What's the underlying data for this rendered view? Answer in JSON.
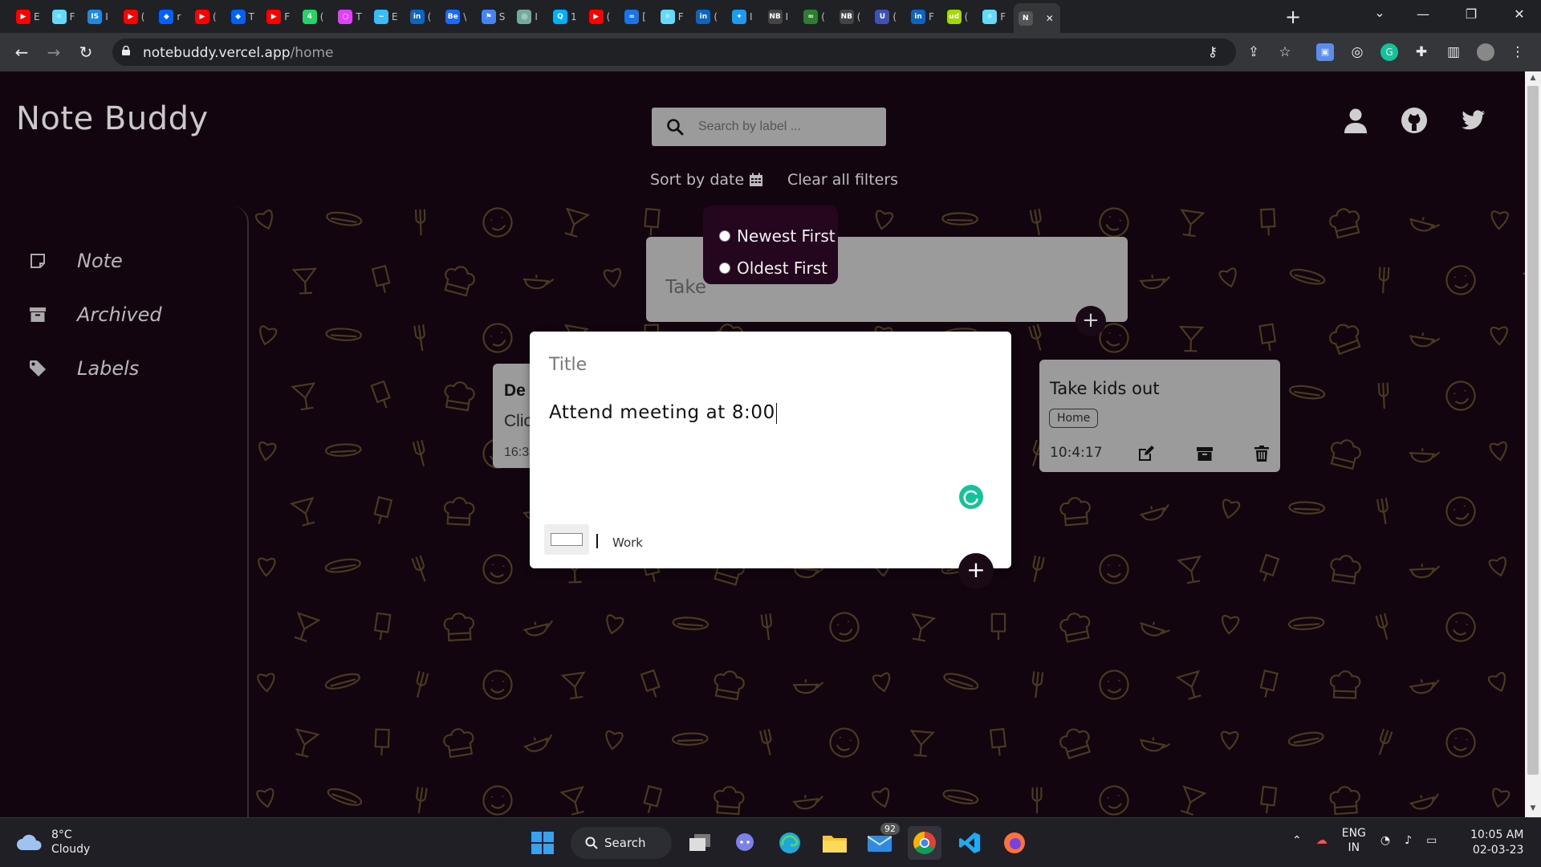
{
  "browser": {
    "tabs": [
      {
        "icon": "youtube-icon",
        "color": "#ff0000",
        "glyph": "▶",
        "letter": "E"
      },
      {
        "icon": "react-icon",
        "color": "#61dafb",
        "glyph": "⚛",
        "letter": "F"
      },
      {
        "icon": "tab-app-icon",
        "color": "#1e88e5",
        "glyph": "IS",
        "letter": "I"
      },
      {
        "icon": "youtube-icon",
        "color": "#ff0000",
        "glyph": "▶",
        "letter": "("
      },
      {
        "icon": "dropbox-icon",
        "color": "#0061fe",
        "glyph": "◆",
        "letter": "r"
      },
      {
        "icon": "youtube-icon",
        "color": "#ff0000",
        "glyph": "▶",
        "letter": "("
      },
      {
        "icon": "dropbox-icon",
        "color": "#0061fe",
        "glyph": "◆",
        "letter": "T"
      },
      {
        "icon": "youtube-icon",
        "color": "#ff0000",
        "glyph": "▶",
        "letter": "F"
      },
      {
        "icon": "whatsapp-icon",
        "color": "#25d366",
        "glyph": "4",
        "letter": "("
      },
      {
        "icon": "ring-icon",
        "color": "#e040fb",
        "glyph": "○",
        "letter": "T"
      },
      {
        "icon": "tailwind-icon",
        "color": "#38bdf8",
        "glyph": "~",
        "letter": "E"
      },
      {
        "icon": "linkedin-icon",
        "color": "#0a66c2",
        "glyph": "in",
        "letter": "("
      },
      {
        "icon": "behance-icon",
        "color": "#1769ff",
        "glyph": "Be",
        "letter": "\\"
      },
      {
        "icon": "flag-icon",
        "color": "#4285f4",
        "glyph": "⚑",
        "letter": "S"
      },
      {
        "icon": "chatgpt-icon",
        "color": "#74aa9c",
        "glyph": "◎",
        "letter": "I"
      },
      {
        "icon": "search-tab-icon",
        "color": "#00b0ff",
        "glyph": "Q",
        "letter": "1"
      },
      {
        "icon": "youtube-icon",
        "color": "#ff0000",
        "glyph": "▶",
        "letter": "("
      },
      {
        "icon": "infinity-icon",
        "color": "#1a73e8",
        "glyph": "∞",
        "letter": "["
      },
      {
        "icon": "react-icon",
        "color": "#61dafb",
        "glyph": "⚛",
        "letter": "F"
      },
      {
        "icon": "linkedin-icon",
        "color": "#0a66c2",
        "glyph": "in",
        "letter": "("
      },
      {
        "icon": "twitter-icon",
        "color": "#1d9bf0",
        "glyph": "✦",
        "letter": "I"
      },
      {
        "icon": "notebuddy-icon",
        "color": "#444444",
        "glyph": "NB",
        "letter": "I"
      },
      {
        "icon": "infinity-icon",
        "color": "#2e7d32",
        "glyph": "∞",
        "letter": "("
      },
      {
        "icon": "notebuddy-icon",
        "color": "#444444",
        "glyph": "NB",
        "letter": "("
      },
      {
        "icon": "u-icon",
        "color": "#3f51b5",
        "glyph": "U",
        "letter": "("
      },
      {
        "icon": "linkedin-icon",
        "color": "#0a66c2",
        "glyph": "in",
        "letter": "F"
      },
      {
        "icon": "ud-icon",
        "color": "#a3d900",
        "glyph": "ud",
        "letter": "("
      },
      {
        "icon": "react-icon",
        "color": "#61dafb",
        "glyph": "⚛",
        "letter": "F"
      },
      {
        "icon": "notebuddy-icon",
        "color": "#555555",
        "glyph": "N",
        "letter": "",
        "active": true
      }
    ],
    "url_host": "notebuddy.vercel.app",
    "url_path": "/home"
  },
  "app": {
    "title": "Note Buddy",
    "search_placeholder": "Search by label ...",
    "sort_by_date": "Sort by date",
    "clear_filters": "Clear all filters"
  },
  "sidebar": {
    "items": [
      {
        "label": "Note",
        "icon": "note-icon"
      },
      {
        "label": "Archived",
        "icon": "archive-icon"
      },
      {
        "label": "Labels",
        "icon": "tag-icon"
      }
    ]
  },
  "sort_dropdown": {
    "options": [
      "Newest First",
      "Oldest First"
    ]
  },
  "take_note": {
    "placeholder": "Take"
  },
  "behind_card": {
    "title": "De",
    "body": "Clic",
    "time": "16:3"
  },
  "note_card": {
    "title": "Take kids out",
    "label": "Home",
    "time": "10:4:17"
  },
  "editor": {
    "title_placeholder": "Title",
    "body": "Attend meeting at 8:00",
    "label": "Work"
  },
  "taskbar": {
    "weather_temp": "8°C",
    "weather_desc": "Cloudy",
    "search_label": "Search",
    "mail_badge": "92",
    "lang_top": "ENG",
    "lang_bottom": "IN",
    "time": "10:05 AM",
    "date": "02-03-23"
  },
  "colors": {
    "page_bg": "#120510",
    "card_bg": "#9b9b9b",
    "dropdown_bg": "#25061f",
    "pattern_stroke": "#4a3a1e",
    "grammarly": "#15c39a"
  }
}
